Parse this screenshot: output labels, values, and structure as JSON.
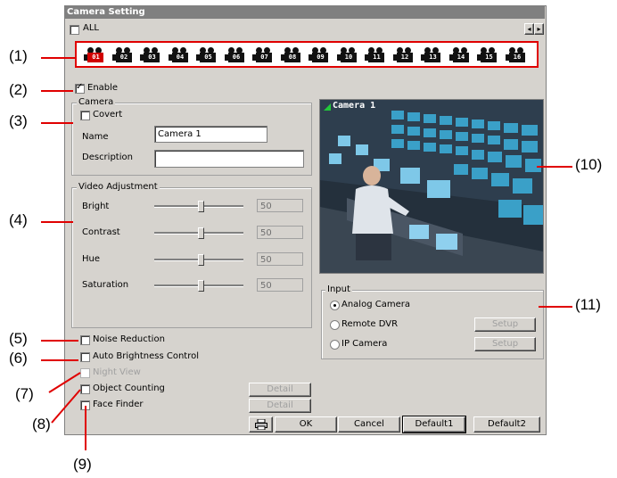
{
  "window": {
    "title": "Camera Setting"
  },
  "all_label": "ALL",
  "cameras": [
    "01",
    "02",
    "03",
    "04",
    "05",
    "06",
    "07",
    "08",
    "09",
    "10",
    "11",
    "12",
    "13",
    "14",
    "15",
    "16"
  ],
  "enable_label": "Enable",
  "camera_group": {
    "title": "Camera",
    "covert_label": "Covert",
    "name_label": "Name",
    "name_value": "Camera 1",
    "description_label": "Description",
    "description_value": ""
  },
  "video_group": {
    "title": "Video Adjustment",
    "rows": [
      {
        "label": "Bright",
        "value": "50"
      },
      {
        "label": "Contrast",
        "value": "50"
      },
      {
        "label": "Hue",
        "value": "50"
      },
      {
        "label": "Saturation",
        "value": "50"
      }
    ]
  },
  "options": {
    "noise": "Noise Reduction",
    "auto_brightness": "Auto Brightness Control",
    "night_view": "Night View",
    "object_counting": "Object Counting",
    "face_finder": "Face Finder",
    "detail": "Detail"
  },
  "preview": {
    "overlay": "Camera 1"
  },
  "input_group": {
    "title": "Input",
    "analog": "Analog Camera",
    "remote": "Remote DVR",
    "ip": "IP Camera",
    "setup": "Setup"
  },
  "buttons": {
    "ok": "OK",
    "cancel": "Cancel",
    "default1": "Default1",
    "default2": "Default2"
  },
  "callouts": [
    "(1)",
    "(2)",
    "(3)",
    "(4)",
    "(5)",
    "(6)",
    "(7)",
    "(8)",
    "(9)",
    "(10)",
    "(11)"
  ],
  "colors": {
    "callout_line": "#e00000",
    "dialog_bg": "#d6d3ce",
    "active_camera": "#d00000"
  }
}
